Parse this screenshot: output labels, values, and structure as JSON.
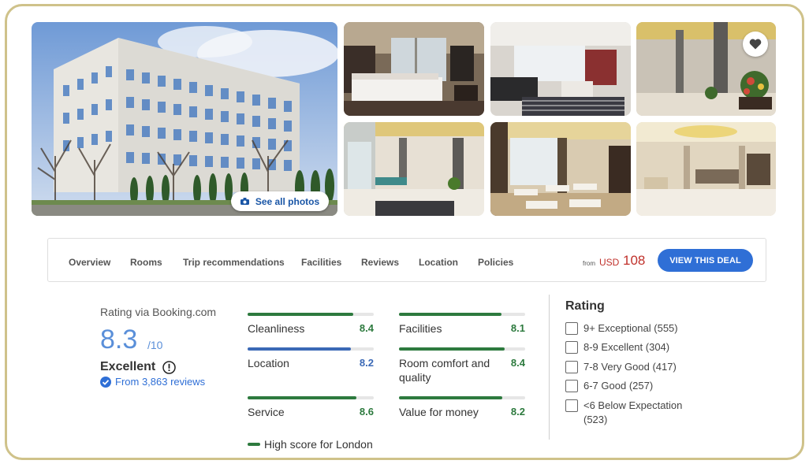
{
  "gallery": {
    "see_all_label": "See all photos"
  },
  "nav": {
    "tabs": [
      "Overview",
      "Rooms",
      "Trip recommendations",
      "Facilities",
      "Reviews",
      "Location",
      "Policies"
    ],
    "price_from": "from",
    "price_currency": "USD",
    "price_value": "108",
    "deal_button": "VIEW THIS DEAL"
  },
  "summary": {
    "via": "Rating via Booking.com",
    "score": "8.3",
    "score_denominator": "/10",
    "label": "Excellent",
    "reviews": "From 3,863 reviews"
  },
  "categories": [
    {
      "label": "Cleanliness",
      "value": "8.4",
      "score": 8.4,
      "color": "#2d7a3e"
    },
    {
      "label": "Location",
      "value": "8.2",
      "score": 8.2,
      "color": "#3b69b6"
    },
    {
      "label": "Service",
      "value": "8.6",
      "score": 8.6,
      "color": "#2d7a3e"
    },
    {
      "label": "Facilities",
      "value": "8.1",
      "score": 8.1,
      "color": "#2d7a3e"
    },
    {
      "label": "Room comfort and quality",
      "value": "8.4",
      "score": 8.4,
      "color": "#2d7a3e"
    },
    {
      "label": "Value for money",
      "value": "8.2",
      "score": 8.2,
      "color": "#2d7a3e"
    }
  ],
  "legend": {
    "text": "High score for London",
    "color": "#2d7a3e"
  },
  "filter": {
    "title": "Rating",
    "options": [
      "9+ Exceptional (555)",
      "8-9 Excellent (304)",
      "7-8 Very Good (417)",
      "6-7 Good (257)",
      "<6 Below Expectation (523)"
    ]
  },
  "colors": {
    "accent": "#2f6fd6",
    "price": "#c0312b",
    "score": "#5a8fd9",
    "frame": "#cfc28a"
  }
}
